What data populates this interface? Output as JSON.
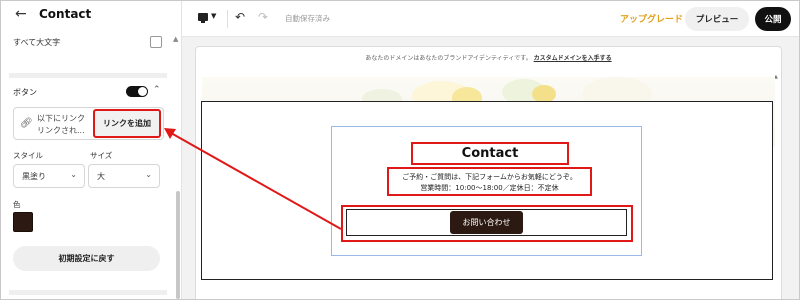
{
  "panel": {
    "back_icon": "arrow-left-icon",
    "title": "Contact",
    "all_caps_label": "すべて大文字",
    "button_section_label": "ボタン",
    "button_toggle_on": true,
    "link_text_line1": "以下にリンク",
    "link_text_line2": "リンクされ...",
    "add_link_label": "リンクを追加",
    "style_label": "スタイル",
    "style_value": "黒塗り",
    "size_label": "サイズ",
    "size_value": "大",
    "color_label": "色",
    "color_value": "#2c1a12",
    "reset_label": "初期設定に戻す"
  },
  "topbar": {
    "device_icon": "desktop-icon",
    "undo_icon": "undo-icon",
    "redo_icon": "redo-icon",
    "autosave_label": "自動保存済み",
    "upgrade_label": "アップグレード",
    "preview_label": "プレビュー",
    "publish_label": "公開"
  },
  "page": {
    "domain_banner_text": "あなたのドメインはあなたのブランドアイデンティティです。",
    "domain_banner_link": "カスタムドメインを入手する"
  },
  "contact": {
    "title": "Contact",
    "desc_line1": "ご予約・ご質問は、下記フォームからお気軽にどうぞ。",
    "desc_line2": "営業時間：10:00〜18:00／定休日：不定休",
    "button_label": "お問い合わせ"
  },
  "colors": {
    "highlight": "#e01818",
    "upgrade": "#e0a11e",
    "button_fill": "#2c1a12"
  }
}
